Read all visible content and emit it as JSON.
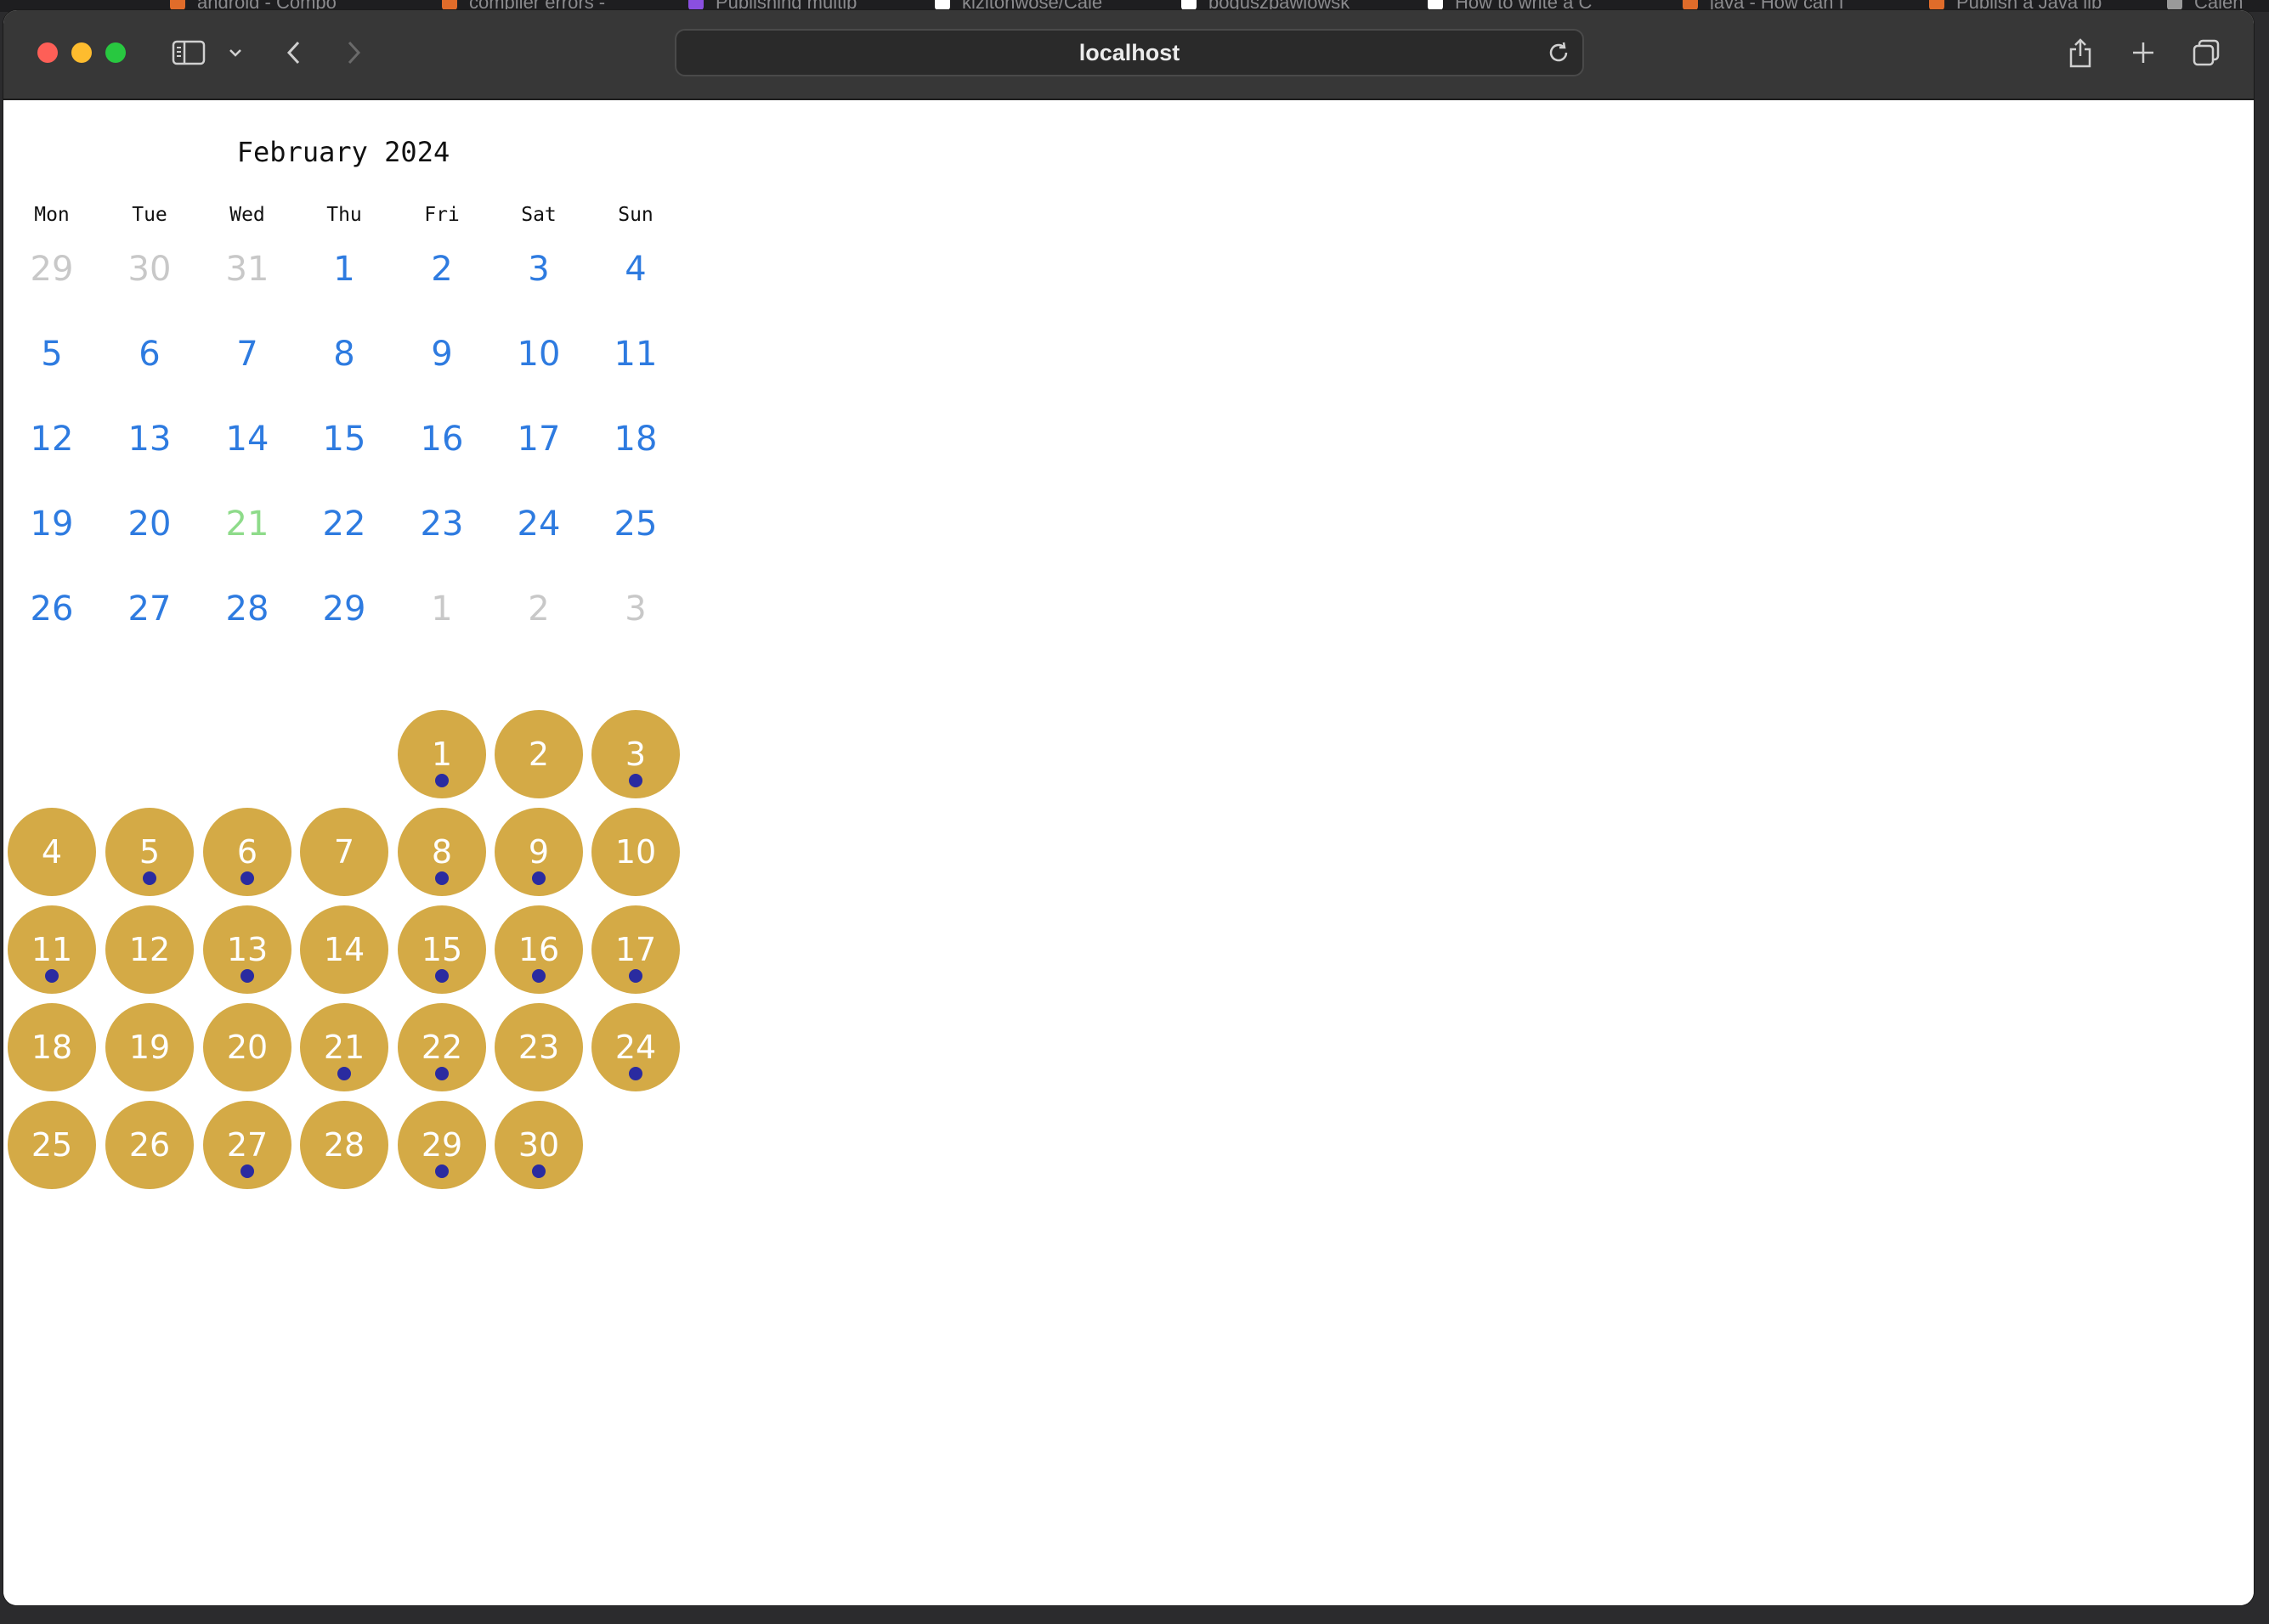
{
  "background_tabs": [
    {
      "title": "android - Compo",
      "icon_color": "#e06c2a"
    },
    {
      "title": "compiler errors -",
      "icon_color": "#e06c2a"
    },
    {
      "title": "Publishing multip",
      "icon_color": "#8a4fe0"
    },
    {
      "title": "kizitonwose/Cale",
      "icon_color": "#ffffff"
    },
    {
      "title": "boguszpawlowsk",
      "icon_color": "#ffffff"
    },
    {
      "title": "How to write a C",
      "icon_color": "#ffffff"
    },
    {
      "title": "java - How can I",
      "icon_color": "#e06c2a"
    },
    {
      "title": "Publish a Java lib",
      "icon_color": "#e06c2a"
    },
    {
      "title": "Calen",
      "icon_color": "#9a9a9a"
    }
  ],
  "browser": {
    "address": "localhost",
    "icons": {
      "sidebar": "sidebar-icon",
      "chevron": "chevron-down-icon",
      "back": "back-icon",
      "forward": "forward-icon",
      "share": "share-icon",
      "new_tab": "plus-icon",
      "tabs": "tab-overview-icon",
      "reload": "reload-icon"
    }
  },
  "calendar": {
    "title": "February 2024",
    "weekdays": [
      "Mon",
      "Tue",
      "Wed",
      "Thu",
      "Fri",
      "Sat",
      "Sun"
    ],
    "weeks": [
      [
        {
          "d": "29",
          "k": "other"
        },
        {
          "d": "30",
          "k": "other"
        },
        {
          "d": "31",
          "k": "other"
        },
        {
          "d": "1",
          "k": "cur"
        },
        {
          "d": "2",
          "k": "cur"
        },
        {
          "d": "3",
          "k": "cur"
        },
        {
          "d": "4",
          "k": "cur"
        }
      ],
      [
        {
          "d": "5",
          "k": "cur"
        },
        {
          "d": "6",
          "k": "cur"
        },
        {
          "d": "7",
          "k": "cur"
        },
        {
          "d": "8",
          "k": "cur"
        },
        {
          "d": "9",
          "k": "cur"
        },
        {
          "d": "10",
          "k": "cur"
        },
        {
          "d": "11",
          "k": "cur"
        }
      ],
      [
        {
          "d": "12",
          "k": "cur"
        },
        {
          "d": "13",
          "k": "cur"
        },
        {
          "d": "14",
          "k": "cur"
        },
        {
          "d": "15",
          "k": "cur"
        },
        {
          "d": "16",
          "k": "cur"
        },
        {
          "d": "17",
          "k": "cur"
        },
        {
          "d": "18",
          "k": "cur"
        }
      ],
      [
        {
          "d": "19",
          "k": "cur"
        },
        {
          "d": "20",
          "k": "cur"
        },
        {
          "d": "21",
          "k": "today"
        },
        {
          "d": "22",
          "k": "cur"
        },
        {
          "d": "23",
          "k": "cur"
        },
        {
          "d": "24",
          "k": "cur"
        },
        {
          "d": "25",
          "k": "cur"
        }
      ],
      [
        {
          "d": "26",
          "k": "cur"
        },
        {
          "d": "27",
          "k": "cur"
        },
        {
          "d": "28",
          "k": "cur"
        },
        {
          "d": "29",
          "k": "cur"
        },
        {
          "d": "1",
          "k": "other"
        },
        {
          "d": "2",
          "k": "other"
        },
        {
          "d": "3",
          "k": "other"
        }
      ]
    ],
    "colors": {
      "current_month": "#2e7be0",
      "other_month": "#c8c8c8",
      "today": "#8edb8a",
      "bubble": "#d4aa46",
      "event_dot": "#2a2ba0"
    }
  },
  "day_bubbles": {
    "start_weekday_index": 4,
    "days": [
      {
        "n": "1",
        "dot": true
      },
      {
        "n": "2",
        "dot": false
      },
      {
        "n": "3",
        "dot": true
      },
      {
        "n": "4",
        "dot": false
      },
      {
        "n": "5",
        "dot": true
      },
      {
        "n": "6",
        "dot": true
      },
      {
        "n": "7",
        "dot": false
      },
      {
        "n": "8",
        "dot": true
      },
      {
        "n": "9",
        "dot": true
      },
      {
        "n": "10",
        "dot": false
      },
      {
        "n": "11",
        "dot": true
      },
      {
        "n": "12",
        "dot": false
      },
      {
        "n": "13",
        "dot": true
      },
      {
        "n": "14",
        "dot": false
      },
      {
        "n": "15",
        "dot": true
      },
      {
        "n": "16",
        "dot": true
      },
      {
        "n": "17",
        "dot": true
      },
      {
        "n": "18",
        "dot": false
      },
      {
        "n": "19",
        "dot": false
      },
      {
        "n": "20",
        "dot": false
      },
      {
        "n": "21",
        "dot": true
      },
      {
        "n": "22",
        "dot": true
      },
      {
        "n": "23",
        "dot": false
      },
      {
        "n": "24",
        "dot": true
      },
      {
        "n": "25",
        "dot": false
      },
      {
        "n": "26",
        "dot": false
      },
      {
        "n": "27",
        "dot": true
      },
      {
        "n": "28",
        "dot": false
      },
      {
        "n": "29",
        "dot": true
      },
      {
        "n": "30",
        "dot": true
      }
    ]
  }
}
